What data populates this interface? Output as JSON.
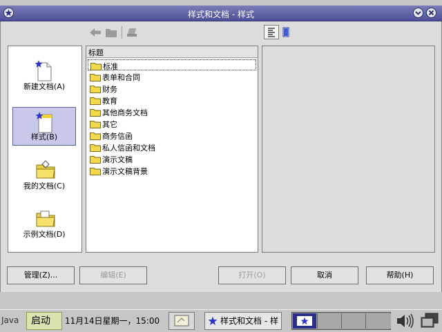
{
  "window": {
    "title": "样式和文档 - 样式"
  },
  "categories": [
    {
      "label": "新建文档(A)"
    },
    {
      "label": "样式(B)"
    },
    {
      "label": "我的文档(C)"
    },
    {
      "label": "示例文档(D)"
    }
  ],
  "list": {
    "column_header": "标题",
    "items": [
      "标准",
      "表单和合同",
      "财务",
      "教育",
      "其他商务文档",
      "其它",
      "商务信函",
      "私人信函和文档",
      "演示文稿",
      "演示文稿背景"
    ]
  },
  "buttons": {
    "manage": "管理(Z)...",
    "edit": "编辑(E)",
    "open": "打开(O)",
    "cancel": "取消",
    "help": "帮助(H)"
  },
  "taskbar": {
    "java": "Java",
    "start": "启动",
    "clock": "11月14日星期一，15:00",
    "task_label": "样式和文档 - 样"
  },
  "colors": {
    "titlebar": "#4d5096",
    "selection": "#c8c9ea"
  }
}
